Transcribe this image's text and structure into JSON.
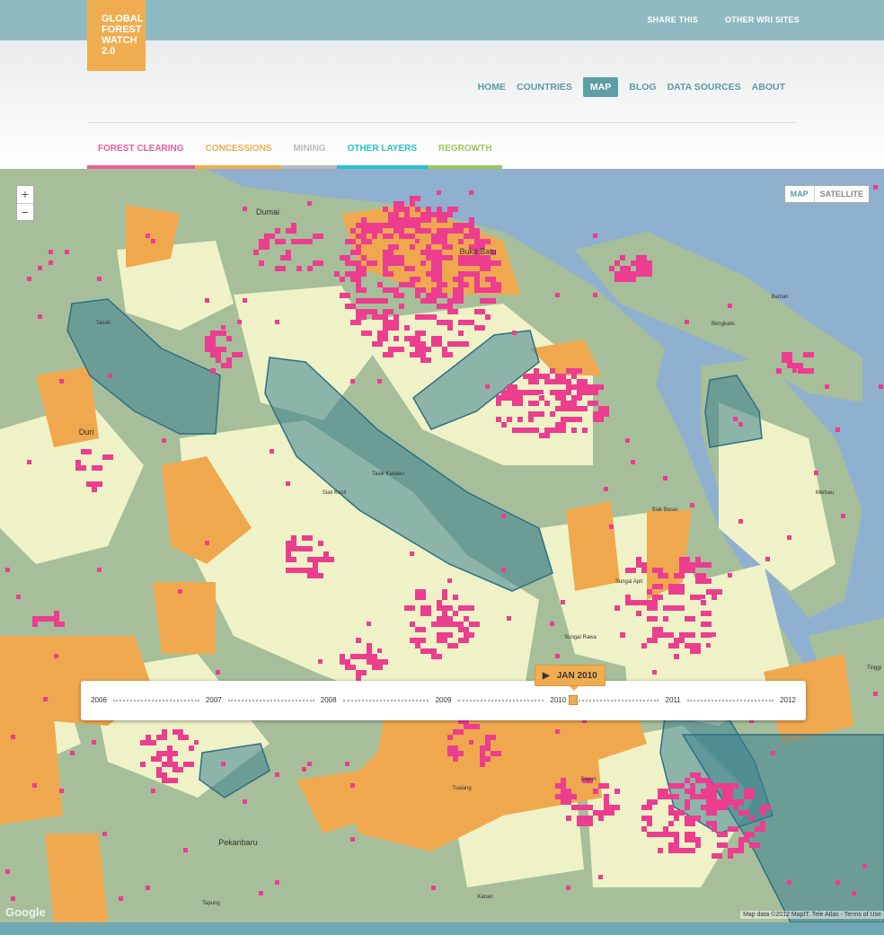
{
  "top_links": [
    "SHARE THIS",
    "OTHER WRI SITES"
  ],
  "logo": {
    "lines": [
      "GLOBAL",
      "FOREST",
      "WATCH",
      "2.0"
    ]
  },
  "nav": {
    "items": [
      "HOME",
      "COUNTRIES",
      "MAP",
      "BLOG",
      "DATA SOURCES",
      "ABOUT"
    ],
    "active": "MAP"
  },
  "layer_tabs": [
    {
      "label": "FOREST CLEARING",
      "color": "#ee5b9b"
    },
    {
      "label": "CONCESSIONS",
      "color": "#f0ad50"
    },
    {
      "label": "MINING",
      "color": "#bbbbbb"
    },
    {
      "label": "OTHER LAYERS",
      "color": "#27c0cc"
    },
    {
      "label": "REGROWTH",
      "color": "#9bc65b"
    }
  ],
  "map": {
    "zoom_in": "+",
    "zoom_out": "−",
    "type_options": [
      "MAP",
      "SATELLITE"
    ],
    "type_selected": "MAP",
    "place_labels": [
      "Dumai",
      "Bukit Batu",
      "Tanah",
      "Duri",
      "Siak Kecil",
      "Tasik Katalau",
      "Bantan",
      "Bengkalis",
      "Merbau",
      "Siak Besar",
      "Sungai Apit",
      "Sungai Rawa",
      "Siak",
      "Dayun",
      "Tualang",
      "Pekanbaru",
      "Tapung",
      "Kanan",
      "Tinggi"
    ],
    "credit": "Map data ©2012 MapIT, Tele Atlas - Terms of Use",
    "google_logo": "Google",
    "colors": {
      "forest": "#a6bf9a",
      "plantation": "#eef2c6",
      "concession": "#f0a84e",
      "clearing": "#ec3d8f",
      "water": "#8fb0cf",
      "protected": "#4f8f9a"
    }
  },
  "timeline": {
    "years": [
      "2006",
      "2007",
      "2008",
      "2009",
      "2010",
      "2011",
      "2012"
    ],
    "current": "JAN 2010",
    "position_year": 2010.0,
    "play_icon": "play-icon"
  }
}
